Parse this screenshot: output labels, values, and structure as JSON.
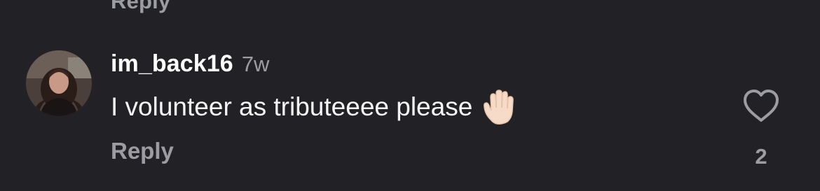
{
  "previous_comment": {
    "reply_label": "Reply"
  },
  "comment": {
    "username": "im_back16",
    "timestamp": "7w",
    "text": "I volunteer as tributeeee please",
    "emoji_icon": "raised-hand-emoji",
    "reply_label": "Reply",
    "like_icon": "heart-outline-icon",
    "like_count": "2"
  },
  "colors": {
    "background": "#222226",
    "primary_text": "#f5f5f5",
    "secondary_text": "#9c9ca3"
  }
}
